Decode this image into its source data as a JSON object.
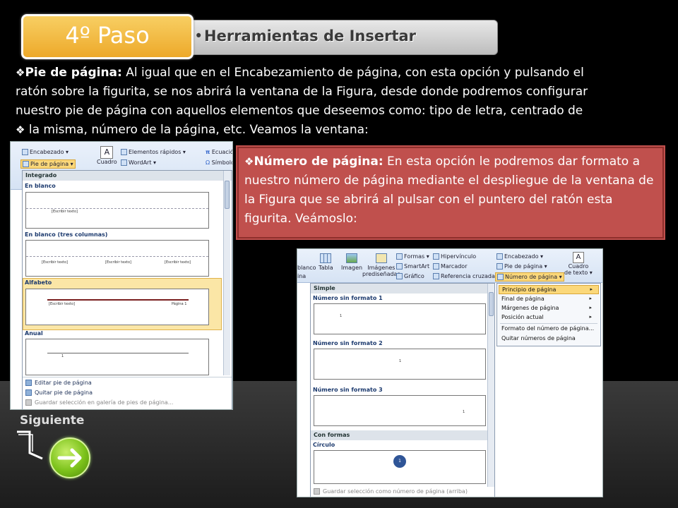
{
  "header": {
    "step_label": "4º  Paso",
    "section_title": "Herramientas de Insertar",
    "bullet": "•"
  },
  "main_text": {
    "bullet_symbol": "❖",
    "term": "Pie de página:",
    "line1_rest": " Al igual que en el Encabezamiento de página, con esta opción y pulsando el",
    "line2": "ratón sobre la figurita, se nos abrirá la ventana de la Figura, desde donde podremos configurar",
    "line3": "nuestro pie de página con aquellos elementos que deseemos como: tipo de letra, centrado de",
    "line4": " la misma, número de la página, etc. Veamos la ventana:"
  },
  "callout": {
    "term": "Número de página:",
    "rest": " En esta opción le podremos dar formato a nuestro número de página mediante el despliegue de la ventana de la Figura que se abrirá al pulsar con el puntero del ratón esta figurita. Veámoslo:"
  },
  "left_screenshot": {
    "ribbon": {
      "encabezado": "Encabezado ▾",
      "pie_de_pagina": "Pie de página ▾",
      "elementos_rapidos": "Elementos rápidos ▾",
      "wordart": "WordArt ▾",
      "cuadro": "Cuadro",
      "ecuacion": "Ecuació",
      "simbolo": "Símbolo",
      "simbolos": "mbolos"
    },
    "group_header": "Integrado",
    "items": [
      {
        "label": "En blanco",
        "placeholder": "[Escribir texto]"
      },
      {
        "label": "En blanco (tres columnas)",
        "placeholders": [
          "[Escribir texto]",
          "[Escribir texto]",
          "[Escribir texto]"
        ]
      },
      {
        "label": "Alfabeto",
        "placeholder": "[Escribir texto]",
        "page": "Página 1"
      },
      {
        "label": "Anual",
        "number": "1"
      }
    ],
    "footer": {
      "edit": "Editar pie de página",
      "remove": "Quitar pie de página",
      "save": "Guardar selección en galería de pies de página..."
    }
  },
  "right_screenshot": {
    "ribbon": {
      "tabla": "Tabla",
      "imagen": "Imagen",
      "imagenes": "Imágenes",
      "prediseñadas": "prediseñadas",
      "formas": "Formas ▾",
      "smartart": "SmartArt",
      "grafico": "Gráfico",
      "hipervinculo": "Hipervínculo",
      "marcador": "Marcador",
      "referencia": "Referencia cruzada",
      "encabezado": "Encabezado ▾",
      "pie": "Pie de página ▾",
      "numero": "Número de página ▾",
      "cuadro": "Cuadro",
      "de_texto": "de texto ▾",
      "left_cut": "blanco",
      "left_cut2": "ina"
    },
    "group_header": "Simple",
    "items": [
      {
        "label": "Número sin formato 1",
        "number": "1"
      },
      {
        "label": "Número sin formato 2",
        "number": "1"
      },
      {
        "label": "Número sin formato 3",
        "number": "1"
      }
    ],
    "group_header2": "Con formas",
    "item_circle": {
      "label": "Círculo",
      "number": "1"
    },
    "save": "Guardar selección como número de página (arriba)",
    "submenu": [
      "Principio de página",
      "Final de página",
      "Márgenes de página",
      "Posición actual",
      "Formato del número de página...",
      "Quitar números de página"
    ]
  },
  "nav": {
    "next_label": "Siguiente",
    "next_arrow": "→"
  },
  "colors": {
    "step_box": "#eda92a",
    "callout": "#c0504d",
    "next_button": "#7cc21b"
  }
}
